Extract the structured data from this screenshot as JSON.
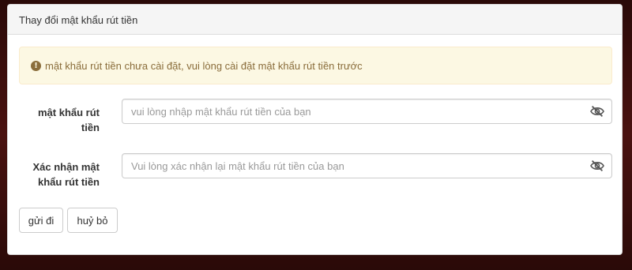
{
  "panel": {
    "title": "Thay đổi mật khẩu rút tiền"
  },
  "alert": {
    "icon": "exclamation-circle-icon",
    "text": "mật khẩu rút tiền chưa cài đặt, vui lòng cài đặt mật khẩu rút tiền trước"
  },
  "form": {
    "password": {
      "label_line1": "mật khẩu rút",
      "label_line2": "tiền",
      "placeholder": "vui lòng nhập mật khẩu rút tiền của bạn",
      "value": "",
      "toggle_icon": "eye-slash-icon"
    },
    "confirm": {
      "label_line1": "Xác nhận mật",
      "label_line2": "khẩu rút tiền",
      "placeholder": "Vui lòng xác nhận lại mật khẩu rút tiền của bạn",
      "value": "",
      "toggle_icon": "eye-slash-icon"
    }
  },
  "buttons": {
    "submit": "gửi đi",
    "cancel": "huỷ bỏ"
  },
  "colors": {
    "alert_bg": "#fcf8e3",
    "alert_text": "#8a6d3b",
    "background": "#3a0d0d"
  }
}
